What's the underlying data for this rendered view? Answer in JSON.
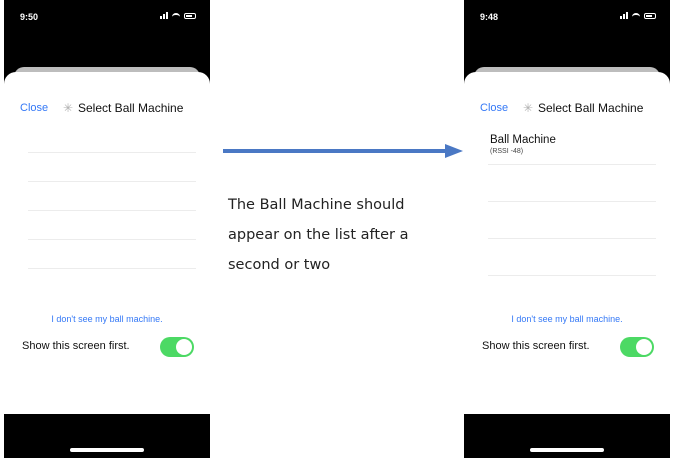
{
  "left_phone": {
    "time": "9:50",
    "close_label": "Close",
    "title": "Select Ball Machine",
    "cant_see_label": "I don't see my ball machine.",
    "show_first_label": "Show this screen first.",
    "toggle_on": true
  },
  "right_phone": {
    "time": "9:48",
    "close_label": "Close",
    "title": "Select Ball Machine",
    "device_name": "Ball Machine",
    "device_rssi": "(RSSI -48)",
    "cant_see_label": "I don't see my ball machine.",
    "show_first_label": "Show this screen first.",
    "toggle_on": true
  },
  "caption": "The Ball Machine should appear on the list after a second or two",
  "colors": {
    "link": "#3478f6",
    "toggle": "#4cd964",
    "arrow": "#4a78c4"
  }
}
